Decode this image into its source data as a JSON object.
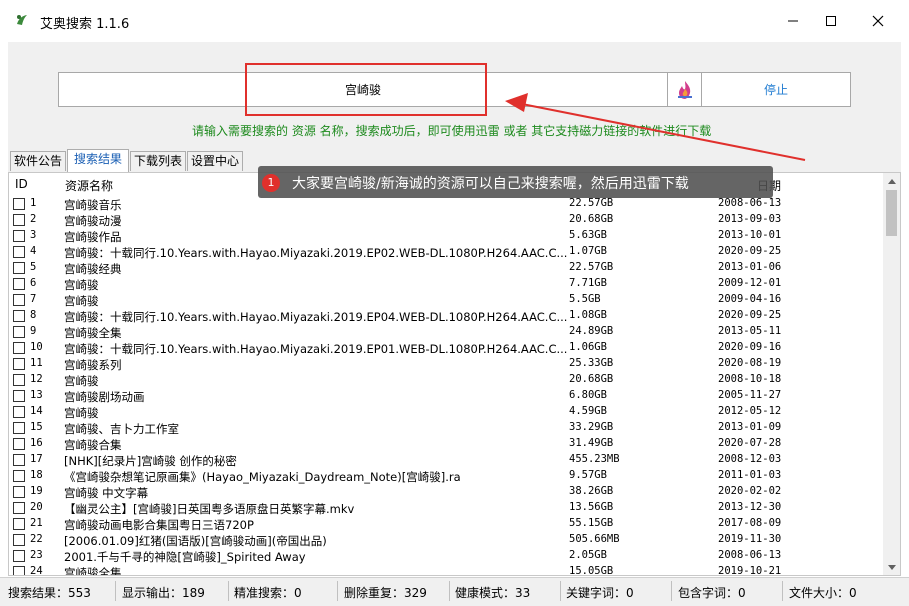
{
  "window": {
    "title": "艾奥搜索 1.1.6",
    "minimize": "minimize",
    "maximize": "maximize",
    "close": "close"
  },
  "search": {
    "value": "宫崎骏",
    "stop_label": "停止",
    "hint": "请输入需要搜索的 资源 名称，搜索成功后，即可使用迅雷 或者 其它支持磁力链接的软件进行下载"
  },
  "tabs": [
    "软件公告",
    "搜索结果",
    "下载列表",
    "设置中心"
  ],
  "active_tab": 1,
  "list": {
    "headers": {
      "id": "ID",
      "name": "资源名称",
      "date": "日期"
    },
    "rows": [
      {
        "id": "1",
        "name": "宫崎骏音乐",
        "size": "22.57GB",
        "date": "2008-06-13"
      },
      {
        "id": "2",
        "name": "宫崎骏动漫",
        "size": "20.68GB",
        "date": "2013-09-03"
      },
      {
        "id": "3",
        "name": "宫崎骏作品",
        "size": "5.63GB",
        "date": "2013-10-01"
      },
      {
        "id": "4",
        "name": "宫崎骏：十载同行.10.Years.with.Hayao.Miyazaki.2019.EP02.WEB-DL.1080P.H264.AAC.C...",
        "size": "1.07GB",
        "date": "2020-09-25"
      },
      {
        "id": "5",
        "name": "宫崎骏经典",
        "size": "22.57GB",
        "date": "2013-01-06"
      },
      {
        "id": "6",
        "name": "宫崎骏",
        "size": "7.71GB",
        "date": "2009-12-01"
      },
      {
        "id": "7",
        "name": "宫崎骏",
        "size": "5.5GB",
        "date": "2009-04-16"
      },
      {
        "id": "8",
        "name": "宫崎骏：十载同行.10.Years.with.Hayao.Miyazaki.2019.EP04.WEB-DL.1080P.H264.AAC.C...",
        "size": "1.08GB",
        "date": "2020-09-25"
      },
      {
        "id": "9",
        "name": "宫崎骏全集",
        "size": "24.89GB",
        "date": "2013-05-11"
      },
      {
        "id": "10",
        "name": "宫崎骏：十载同行.10.Years.with.Hayao.Miyazaki.2019.EP01.WEB-DL.1080P.H264.AAC.C...",
        "size": "1.06GB",
        "date": "2020-09-16"
      },
      {
        "id": "11",
        "name": "宫崎骏系列",
        "size": "25.33GB",
        "date": "2020-08-19"
      },
      {
        "id": "12",
        "name": "宫崎骏",
        "size": "20.68GB",
        "date": "2008-10-18"
      },
      {
        "id": "13",
        "name": "宫崎骏剧场动画",
        "size": "6.80GB",
        "date": "2005-11-27"
      },
      {
        "id": "14",
        "name": "宫崎骏",
        "size": "4.59GB",
        "date": "2012-05-12"
      },
      {
        "id": "15",
        "name": "宫崎骏、吉卜力工作室",
        "size": "33.29GB",
        "date": "2013-01-09"
      },
      {
        "id": "16",
        "name": "宫崎骏合集",
        "size": "31.49GB",
        "date": "2020-07-28"
      },
      {
        "id": "17",
        "name": "[NHK][纪录片]宫崎骏 创作的秘密",
        "size": "455.23MB",
        "date": "2008-12-03"
      },
      {
        "id": "18",
        "name": "《宫崎骏杂想笔记原画集》(Hayao_Miyazaki_Daydream_Note)[宫崎骏].ra",
        "size": "9.57GB",
        "date": "2011-01-03"
      },
      {
        "id": "19",
        "name": "宫崎骏 中文字幕",
        "size": "38.26GB",
        "date": "2020-02-02"
      },
      {
        "id": "20",
        "name": "【幽灵公主】[宫崎骏]日英国粤多语原盘日英繁字幕.mkv",
        "size": "13.56GB",
        "date": "2013-12-30"
      },
      {
        "id": "21",
        "name": "宫崎骏动画电影合集国粤日三语720P",
        "size": "55.15GB",
        "date": "2017-08-09"
      },
      {
        "id": "22",
        "name": "[2006.01.09]红猪(国语版)[宫崎骏动画](帝国出品)",
        "size": "505.66MB",
        "date": "2019-11-30"
      },
      {
        "id": "23",
        "name": "2001.千与千寻的神隐[宫崎骏]_Spirited Away",
        "size": "2.05GB",
        "date": "2008-06-13"
      },
      {
        "id": "24",
        "name": "宫崎骏全集",
        "size": "15.05GB",
        "date": "2019-10-21"
      }
    ]
  },
  "status": {
    "search_results": "搜索结果：553",
    "shown": "显示输出：189",
    "exact": "精准搜索：0",
    "dedup": "删除重复：329",
    "healthy": "健康模式：33",
    "keyword": "关键字词：0",
    "contains": "包含字词：0",
    "filesize": "文件大小：0"
  },
  "annotation": {
    "badge": "1",
    "text": "大家要宫崎骏/新海诚的资源可以自己来搜索喔，然后用迅雷下载"
  }
}
